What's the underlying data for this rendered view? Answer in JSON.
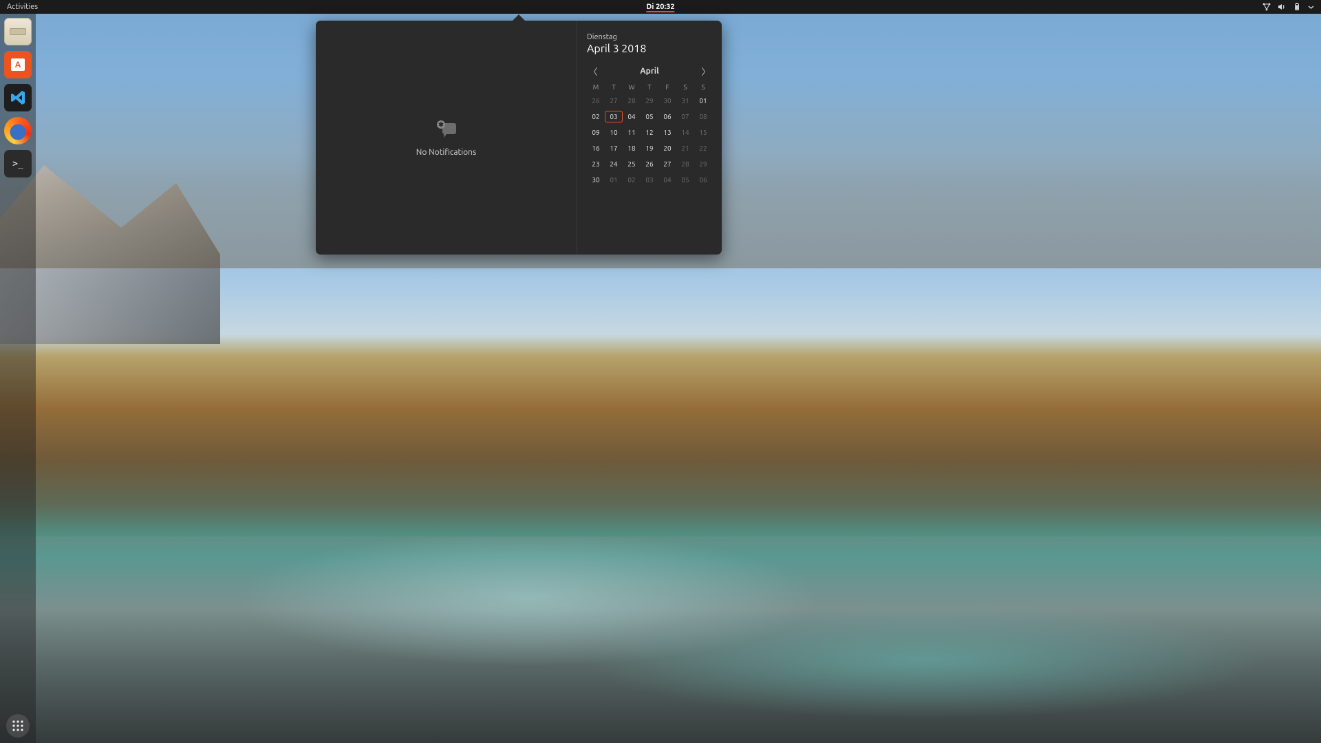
{
  "topbar": {
    "activities": "Activities",
    "clock": "Di 20:32"
  },
  "dock": {
    "apps": [
      {
        "name": "files",
        "label": "Files"
      },
      {
        "name": "software",
        "label": "Ubuntu Software"
      },
      {
        "name": "vscode",
        "label": "Visual Studio Code"
      },
      {
        "name": "firefox",
        "label": "Firefox"
      },
      {
        "name": "terminal",
        "label": "Terminal"
      }
    ],
    "showapps_label": "Show Applications"
  },
  "popover": {
    "notifications_empty": "No Notifications",
    "weekday": "Dienstag",
    "date": "April  3 2018",
    "month": "April",
    "dow": [
      "M",
      "T",
      "W",
      "T",
      "F",
      "S",
      "S"
    ],
    "today": "03",
    "weeks": [
      [
        {
          "n": "26",
          "dim": true
        },
        {
          "n": "27",
          "dim": true
        },
        {
          "n": "28",
          "dim": true
        },
        {
          "n": "29",
          "dim": true
        },
        {
          "n": "30",
          "dim": true
        },
        {
          "n": "31",
          "dim": true
        },
        {
          "n": "01"
        }
      ],
      [
        {
          "n": "02"
        },
        {
          "n": "03"
        },
        {
          "n": "04"
        },
        {
          "n": "05"
        },
        {
          "n": "06"
        },
        {
          "n": "07",
          "dim": true
        },
        {
          "n": "08",
          "dim": true
        }
      ],
      [
        {
          "n": "09"
        },
        {
          "n": "10"
        },
        {
          "n": "11"
        },
        {
          "n": "12"
        },
        {
          "n": "13"
        },
        {
          "n": "14",
          "dim": true
        },
        {
          "n": "15",
          "dim": true
        }
      ],
      [
        {
          "n": "16"
        },
        {
          "n": "17"
        },
        {
          "n": "18"
        },
        {
          "n": "19"
        },
        {
          "n": "20"
        },
        {
          "n": "21",
          "dim": true
        },
        {
          "n": "22",
          "dim": true
        }
      ],
      [
        {
          "n": "23"
        },
        {
          "n": "24"
        },
        {
          "n": "25"
        },
        {
          "n": "26"
        },
        {
          "n": "27"
        },
        {
          "n": "28",
          "dim": true
        },
        {
          "n": "29",
          "dim": true
        }
      ],
      [
        {
          "n": "30"
        },
        {
          "n": "01",
          "dim": true
        },
        {
          "n": "02",
          "dim": true
        },
        {
          "n": "03",
          "dim": true
        },
        {
          "n": "04",
          "dim": true
        },
        {
          "n": "05",
          "dim": true
        },
        {
          "n": "06",
          "dim": true
        }
      ]
    ]
  }
}
